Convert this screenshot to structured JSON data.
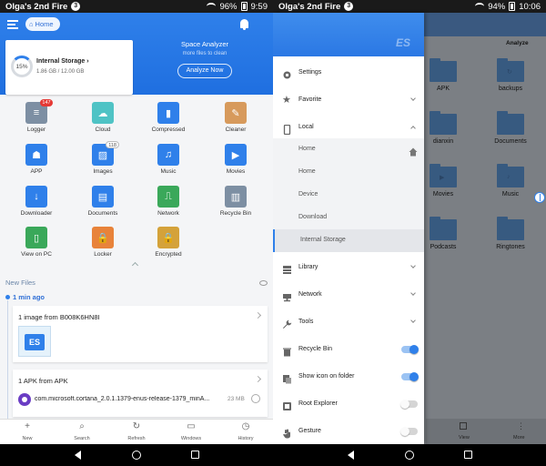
{
  "left": {
    "status": {
      "title": "Olga's 2nd Fire",
      "notif": "3",
      "battery": "96%",
      "time": "9:59"
    },
    "toolbar": {
      "home_label": "Home"
    },
    "storage": {
      "percent": "15%",
      "name": "Internal Storage",
      "size": "1.86 GB / 12.00 GB"
    },
    "analyzer": {
      "title": "Space Analyzer",
      "subtitle": "more files to clean",
      "button": "Analyze Now"
    },
    "grid": [
      {
        "label": "Logger",
        "icon": "logger-icon",
        "color": "#7d8fa3",
        "glyph": "≡",
        "badge": "147"
      },
      {
        "label": "Cloud",
        "icon": "cloud-icon",
        "color": "#4fc3c5",
        "glyph": "☁"
      },
      {
        "label": "Compressed",
        "icon": "compressed-icon",
        "color": "#2f80ea",
        "glyph": "▮"
      },
      {
        "label": "Cleaner",
        "icon": "cleaner-icon",
        "color": "#d79a5c",
        "glyph": "✎"
      },
      {
        "label": "APP",
        "icon": "android-icon",
        "color": "#2f80ea",
        "glyph": "☗"
      },
      {
        "label": "Images",
        "icon": "images-icon",
        "color": "#2f80ea",
        "glyph": "▨",
        "badge": "118",
        "badge_style": "grey"
      },
      {
        "label": "Music",
        "icon": "music-icon",
        "color": "#2f80ea",
        "glyph": "♫"
      },
      {
        "label": "Movies",
        "icon": "movies-icon",
        "color": "#2f80ea",
        "glyph": "▶"
      },
      {
        "label": "Downloader",
        "icon": "download-icon",
        "color": "#2f80ea",
        "glyph": "↓"
      },
      {
        "label": "Documents",
        "icon": "documents-icon",
        "color": "#2f80ea",
        "glyph": "▤"
      },
      {
        "label": "Network",
        "icon": "network-icon",
        "color": "#3aa85a",
        "glyph": "⎍"
      },
      {
        "label": "Recycle Bin",
        "icon": "recycle-bin-icon",
        "color": "#7d8fa3",
        "glyph": "▥"
      },
      {
        "label": "View on PC",
        "icon": "view-on-pc-icon",
        "color": "#3aa85a",
        "glyph": "▯"
      },
      {
        "label": "Locker",
        "icon": "locker-icon",
        "color": "#e8833a",
        "glyph": "🔒"
      },
      {
        "label": "Encrypted",
        "icon": "encrypted-icon",
        "color": "#d4a23a",
        "glyph": "🔒"
      }
    ],
    "new_files": {
      "heading": "New Files",
      "time": "1 min ago"
    },
    "card1": {
      "title": "1 image from B008K6HN8I",
      "thumb": "ES"
    },
    "card2": {
      "title": "1 APK from APK",
      "file": "com.microsoft.cortana_2.0.1.1379-enus-release-1379_minA...",
      "size": "23 MB"
    },
    "nav": [
      {
        "label": "New",
        "icon": "plus-icon",
        "glyph": "+"
      },
      {
        "label": "Search",
        "icon": "search-icon",
        "glyph": "⌕"
      },
      {
        "label": "Refresh",
        "icon": "refresh-icon",
        "glyph": "↻"
      },
      {
        "label": "Windows",
        "icon": "windows-icon",
        "glyph": "▭"
      },
      {
        "label": "History",
        "icon": "history-icon",
        "glyph": "◷"
      }
    ]
  },
  "right": {
    "status": {
      "title": "Olga's 2nd Fire",
      "notif": "3",
      "battery": "94%",
      "time": "10:06"
    },
    "bg": {
      "analyze": "Analyze",
      "view": "View",
      "more": "More"
    },
    "folders": [
      {
        "label": "APK",
        "sym": ""
      },
      {
        "label": "backups",
        "sym": "↻"
      },
      {
        "label": "dianxin",
        "sym": ""
      },
      {
        "label": "Documents",
        "sym": ""
      },
      {
        "label": "Movies",
        "sym": "▶"
      },
      {
        "label": "Music",
        "sym": "♪"
      },
      {
        "label": "Podcasts",
        "sym": ""
      },
      {
        "label": "Ringtones",
        "sym": ""
      }
    ],
    "drawer": {
      "logo": "ES",
      "settings": "Settings",
      "favorite": "Favorite",
      "local": "Local",
      "local_items": [
        "Home",
        "Home",
        "Device",
        "Download",
        "Internal Storage"
      ],
      "library": "Library",
      "network": "Network",
      "tools": "Tools",
      "recycle_bin": "Recycle Bin",
      "show_icon": "Show icon on folder",
      "root_explorer": "Root Explorer",
      "gesture": "Gesture"
    }
  }
}
